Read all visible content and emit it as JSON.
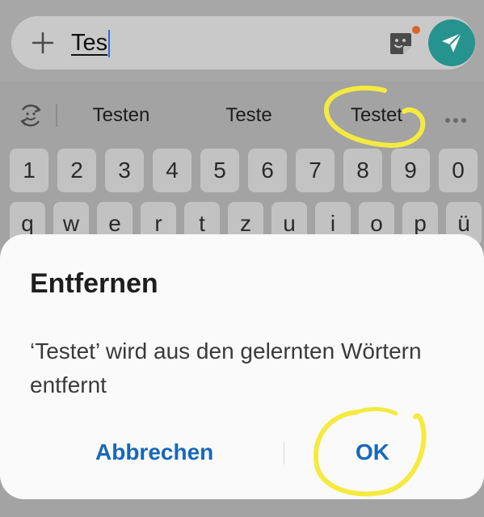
{
  "composer": {
    "text": "Tes",
    "plus_icon": "plus-icon",
    "sticker_icon": "sticker-icon",
    "send_icon": "send-icon",
    "send_color": "#27938e"
  },
  "keyboard": {
    "suggestions": [
      "Testen",
      "Teste",
      "Testet"
    ],
    "suggestion_icon": "predictive-text-icon",
    "more_icon": "more-options-icon",
    "number_row": [
      "1",
      "2",
      "3",
      "4",
      "5",
      "6",
      "7",
      "8",
      "9",
      "0"
    ],
    "letter_row": [
      "q",
      "w",
      "e",
      "r",
      "t",
      "z",
      "u",
      "i",
      "o",
      "p",
      "ü"
    ]
  },
  "dialog": {
    "title": "Entfernen",
    "message": "‘Testet’ wird aus den gelernten Wörtern entfernt",
    "cancel_label": "Abbrechen",
    "ok_label": "OK",
    "button_color": "#1768b8"
  },
  "annotations": {
    "highlight_color": "#f5ea3f"
  }
}
